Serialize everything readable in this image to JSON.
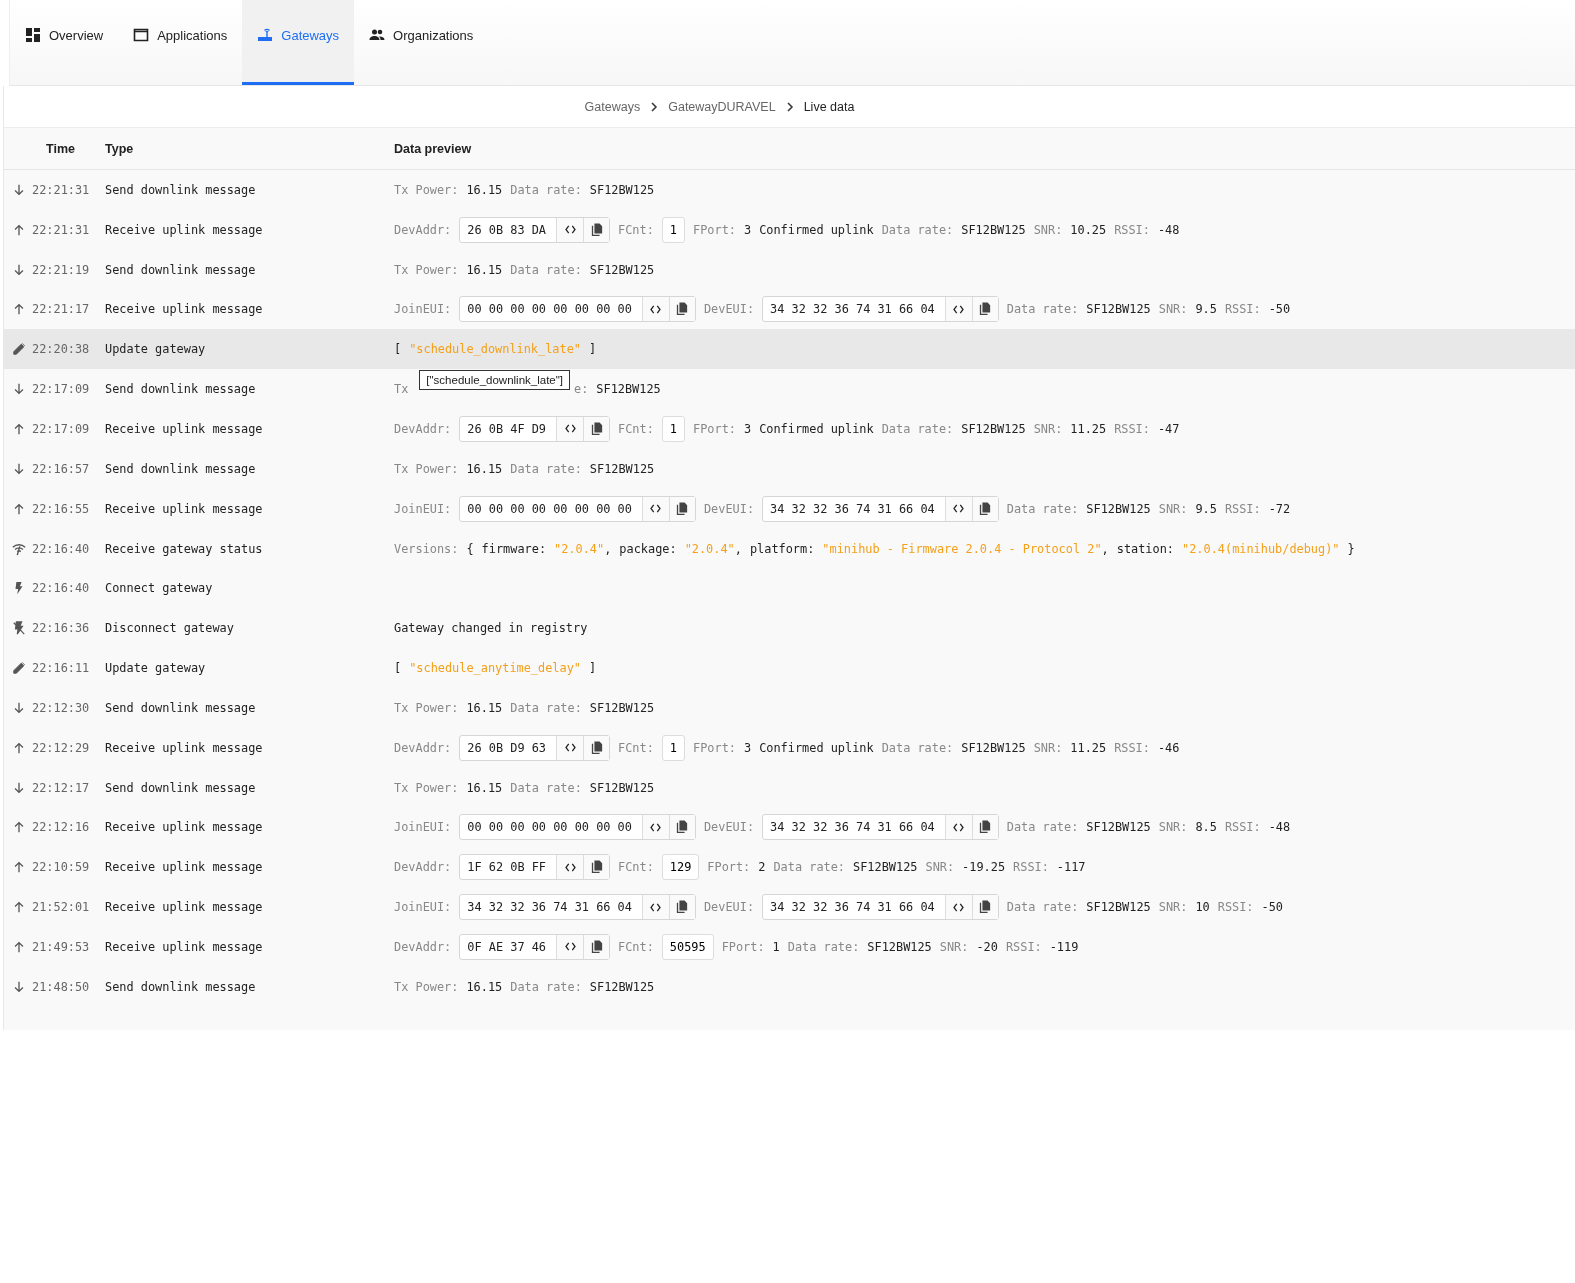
{
  "nav": {
    "tabs": [
      {
        "label": "Overview",
        "kind": "dashboard",
        "selected": false
      },
      {
        "label": "Applications",
        "kind": "window",
        "selected": false
      },
      {
        "label": "Gateways",
        "kind": "router",
        "selected": true
      },
      {
        "label": "Organizations",
        "kind": "people",
        "selected": false
      }
    ]
  },
  "breadcrumb": [
    {
      "label": "Gateways",
      "current": false
    },
    {
      "label": "GatewayDURAVEL",
      "current": false
    },
    {
      "label": "Live data",
      "current": true
    }
  ],
  "table": {
    "columns": [
      "Time",
      "Type",
      "Data preview"
    ],
    "rows": [
      {
        "kind": "down",
        "time": "22:21:31",
        "type": "Send downlink message",
        "highlighted": false,
        "preview": [
          {
            "kind": "label",
            "text": "Tx Power:"
          },
          {
            "kind": "value",
            "text": "16.15"
          },
          {
            "kind": "label",
            "text": "Data rate:"
          },
          {
            "kind": "value",
            "text": "SF12BW125"
          }
        ]
      },
      {
        "kind": "up",
        "time": "22:21:31",
        "type": "Receive uplink message",
        "highlighted": false,
        "preview": [
          {
            "kind": "label",
            "text": "DevAddr:"
          },
          {
            "kind": "field",
            "text": "26 0B 83 DA"
          },
          {
            "kind": "label",
            "text": "FCnt:"
          },
          {
            "kind": "box",
            "text": "1"
          },
          {
            "kind": "label",
            "text": "FPort:"
          },
          {
            "kind": "value",
            "text": "3"
          },
          {
            "kind": "value",
            "text": "Confirmed uplink"
          },
          {
            "kind": "label",
            "text": "Data rate:"
          },
          {
            "kind": "value",
            "text": "SF12BW125"
          },
          {
            "kind": "label",
            "text": "SNR:"
          },
          {
            "kind": "value",
            "text": "10.25"
          },
          {
            "kind": "label",
            "text": "RSSI:"
          },
          {
            "kind": "value",
            "text": "-48"
          }
        ]
      },
      {
        "kind": "down",
        "time": "22:21:19",
        "type": "Send downlink message",
        "highlighted": false,
        "preview": [
          {
            "kind": "label",
            "text": "Tx Power:"
          },
          {
            "kind": "value",
            "text": "16.15"
          },
          {
            "kind": "label",
            "text": "Data rate:"
          },
          {
            "kind": "value",
            "text": "SF12BW125"
          }
        ]
      },
      {
        "kind": "up",
        "time": "22:21:17",
        "type": "Receive uplink message",
        "highlighted": false,
        "preview": [
          {
            "kind": "label",
            "text": "JoinEUI:"
          },
          {
            "kind": "field",
            "text": "00 00 00 00 00 00 00 00"
          },
          {
            "kind": "label",
            "text": "DevEUI:"
          },
          {
            "kind": "field",
            "text": "34 32 32 36 74 31 66 04"
          },
          {
            "kind": "label",
            "text": "Data rate:"
          },
          {
            "kind": "value",
            "text": "SF12BW125"
          },
          {
            "kind": "label",
            "text": "SNR:"
          },
          {
            "kind": "value",
            "text": "9.5"
          },
          {
            "kind": "label",
            "text": "RSSI:"
          },
          {
            "kind": "value",
            "text": "-50"
          }
        ]
      },
      {
        "kind": "edit",
        "time": "22:20:38",
        "type": "Update gateway",
        "highlighted": true,
        "preview": [
          {
            "kind": "value",
            "text": "["
          },
          {
            "kind": "string",
            "text": "\"schedule_downlink_late\""
          },
          {
            "kind": "value",
            "text": "]"
          }
        ]
      },
      {
        "kind": "down",
        "time": "22:17:09",
        "type": "Send downlink message",
        "highlighted": false,
        "preview": [
          {
            "kind": "label",
            "text": "Tx"
          },
          {
            "kind": "tooltip",
            "text": "[\"schedule_downlink_late\"]"
          },
          {
            "kind": "label",
            "text": "e:"
          },
          {
            "kind": "value",
            "text": "SF12BW125"
          }
        ]
      },
      {
        "kind": "up",
        "time": "22:17:09",
        "type": "Receive uplink message",
        "highlighted": false,
        "preview": [
          {
            "kind": "label",
            "text": "DevAddr:"
          },
          {
            "kind": "field",
            "text": "26 0B 4F D9"
          },
          {
            "kind": "label",
            "text": "FCnt:"
          },
          {
            "kind": "box",
            "text": "1"
          },
          {
            "kind": "label",
            "text": "FPort:"
          },
          {
            "kind": "value",
            "text": "3"
          },
          {
            "kind": "value",
            "text": "Confirmed uplink"
          },
          {
            "kind": "label",
            "text": "Data rate:"
          },
          {
            "kind": "value",
            "text": "SF12BW125"
          },
          {
            "kind": "label",
            "text": "SNR:"
          },
          {
            "kind": "value",
            "text": "11.25"
          },
          {
            "kind": "label",
            "text": "RSSI:"
          },
          {
            "kind": "value",
            "text": "-47"
          }
        ]
      },
      {
        "kind": "down",
        "time": "22:16:57",
        "type": "Send downlink message",
        "highlighted": false,
        "preview": [
          {
            "kind": "label",
            "text": "Tx Power:"
          },
          {
            "kind": "value",
            "text": "16.15"
          },
          {
            "kind": "label",
            "text": "Data rate:"
          },
          {
            "kind": "value",
            "text": "SF12BW125"
          }
        ]
      },
      {
        "kind": "up",
        "time": "22:16:55",
        "type": "Receive uplink message",
        "highlighted": false,
        "preview": [
          {
            "kind": "label",
            "text": "JoinEUI:"
          },
          {
            "kind": "field",
            "text": "00 00 00 00 00 00 00 00"
          },
          {
            "kind": "label",
            "text": "DevEUI:"
          },
          {
            "kind": "field",
            "text": "34 32 32 36 74 31 66 04"
          },
          {
            "kind": "label",
            "text": "Data rate:"
          },
          {
            "kind": "value",
            "text": "SF12BW125"
          },
          {
            "kind": "label",
            "text": "SNR:"
          },
          {
            "kind": "value",
            "text": "9.5"
          },
          {
            "kind": "label",
            "text": "RSSI:"
          },
          {
            "kind": "value",
            "text": "-72"
          }
        ]
      },
      {
        "kind": "status",
        "time": "22:16:40",
        "type": "Receive gateway status",
        "highlighted": false,
        "preview": [
          {
            "kind": "label",
            "text": "Versions:"
          },
          {
            "kind": "value",
            "text": "{"
          },
          {
            "kind": "value",
            "text": "firmware:"
          },
          {
            "kind": "string",
            "text": "\"2.0.4\""
          },
          {
            "kind": "punct",
            "text": ","
          },
          {
            "kind": "value",
            "text": "package:"
          },
          {
            "kind": "string",
            "text": "\"2.0.4\""
          },
          {
            "kind": "punct",
            "text": ","
          },
          {
            "kind": "value",
            "text": "platform:"
          },
          {
            "kind": "string",
            "text": "\"minihub - Firmware 2.0.4 - Protocol 2\""
          },
          {
            "kind": "punct",
            "text": ","
          },
          {
            "kind": "value",
            "text": "station:"
          },
          {
            "kind": "string",
            "text": "\"2.0.4(minihub/debug)\""
          },
          {
            "kind": "value",
            "text": "}"
          }
        ]
      },
      {
        "kind": "connect",
        "time": "22:16:40",
        "type": "Connect gateway",
        "highlighted": false,
        "preview": []
      },
      {
        "kind": "disconnect",
        "time": "22:16:36",
        "type": "Disconnect gateway",
        "highlighted": false,
        "preview": [
          {
            "kind": "value",
            "text": "Gateway changed in registry"
          }
        ]
      },
      {
        "kind": "edit",
        "time": "22:16:11",
        "type": "Update gateway",
        "highlighted": false,
        "preview": [
          {
            "kind": "value",
            "text": "["
          },
          {
            "kind": "string",
            "text": "\"schedule_anytime_delay\""
          },
          {
            "kind": "value",
            "text": "]"
          }
        ]
      },
      {
        "kind": "down",
        "time": "22:12:30",
        "type": "Send downlink message",
        "highlighted": false,
        "preview": [
          {
            "kind": "label",
            "text": "Tx Power:"
          },
          {
            "kind": "value",
            "text": "16.15"
          },
          {
            "kind": "label",
            "text": "Data rate:"
          },
          {
            "kind": "value",
            "text": "SF12BW125"
          }
        ]
      },
      {
        "kind": "up",
        "time": "22:12:29",
        "type": "Receive uplink message",
        "highlighted": false,
        "preview": [
          {
            "kind": "label",
            "text": "DevAddr:"
          },
          {
            "kind": "field",
            "text": "26 0B D9 63"
          },
          {
            "kind": "label",
            "text": "FCnt:"
          },
          {
            "kind": "box",
            "text": "1"
          },
          {
            "kind": "label",
            "text": "FPort:"
          },
          {
            "kind": "value",
            "text": "3"
          },
          {
            "kind": "value",
            "text": "Confirmed uplink"
          },
          {
            "kind": "label",
            "text": "Data rate:"
          },
          {
            "kind": "value",
            "text": "SF12BW125"
          },
          {
            "kind": "label",
            "text": "SNR:"
          },
          {
            "kind": "value",
            "text": "11.25"
          },
          {
            "kind": "label",
            "text": "RSSI:"
          },
          {
            "kind": "value",
            "text": "-46"
          }
        ]
      },
      {
        "kind": "down",
        "time": "22:12:17",
        "type": "Send downlink message",
        "highlighted": false,
        "preview": [
          {
            "kind": "label",
            "text": "Tx Power:"
          },
          {
            "kind": "value",
            "text": "16.15"
          },
          {
            "kind": "label",
            "text": "Data rate:"
          },
          {
            "kind": "value",
            "text": "SF12BW125"
          }
        ]
      },
      {
        "kind": "up",
        "time": "22:12:16",
        "type": "Receive uplink message",
        "highlighted": false,
        "preview": [
          {
            "kind": "label",
            "text": "JoinEUI:"
          },
          {
            "kind": "field",
            "text": "00 00 00 00 00 00 00 00"
          },
          {
            "kind": "label",
            "text": "DevEUI:"
          },
          {
            "kind": "field",
            "text": "34 32 32 36 74 31 66 04"
          },
          {
            "kind": "label",
            "text": "Data rate:"
          },
          {
            "kind": "value",
            "text": "SF12BW125"
          },
          {
            "kind": "label",
            "text": "SNR:"
          },
          {
            "kind": "value",
            "text": "8.5"
          },
          {
            "kind": "label",
            "text": "RSSI:"
          },
          {
            "kind": "value",
            "text": "-48"
          }
        ]
      },
      {
        "kind": "up",
        "time": "22:10:59",
        "type": "Receive uplink message",
        "highlighted": false,
        "preview": [
          {
            "kind": "label",
            "text": "DevAddr:"
          },
          {
            "kind": "field",
            "text": "1F 62 0B FF"
          },
          {
            "kind": "label",
            "text": "FCnt:"
          },
          {
            "kind": "box",
            "text": "129"
          },
          {
            "kind": "label",
            "text": "FPort:"
          },
          {
            "kind": "value",
            "text": "2"
          },
          {
            "kind": "label",
            "text": "Data rate:"
          },
          {
            "kind": "value",
            "text": "SF12BW125"
          },
          {
            "kind": "label",
            "text": "SNR:"
          },
          {
            "kind": "value",
            "text": "-19.25"
          },
          {
            "kind": "label",
            "text": "RSSI:"
          },
          {
            "kind": "value",
            "text": "-117"
          }
        ]
      },
      {
        "kind": "up",
        "time": "21:52:01",
        "type": "Receive uplink message",
        "highlighted": false,
        "preview": [
          {
            "kind": "label",
            "text": "JoinEUI:"
          },
          {
            "kind": "field",
            "text": "34 32 32 36 74 31 66 04"
          },
          {
            "kind": "label",
            "text": "DevEUI:"
          },
          {
            "kind": "field",
            "text": "34 32 32 36 74 31 66 04"
          },
          {
            "kind": "label",
            "text": "Data rate:"
          },
          {
            "kind": "value",
            "text": "SF12BW125"
          },
          {
            "kind": "label",
            "text": "SNR:"
          },
          {
            "kind": "value",
            "text": "10"
          },
          {
            "kind": "label",
            "text": "RSSI:"
          },
          {
            "kind": "value",
            "text": "-50"
          }
        ]
      },
      {
        "kind": "up",
        "time": "21:49:53",
        "type": "Receive uplink message",
        "highlighted": false,
        "preview": [
          {
            "kind": "label",
            "text": "DevAddr:"
          },
          {
            "kind": "field",
            "text": "0F AE 37 46"
          },
          {
            "kind": "label",
            "text": "FCnt:"
          },
          {
            "kind": "box",
            "text": "50595"
          },
          {
            "kind": "label",
            "text": "FPort:"
          },
          {
            "kind": "value",
            "text": "1"
          },
          {
            "kind": "label",
            "text": "Data rate:"
          },
          {
            "kind": "value",
            "text": "SF12BW125"
          },
          {
            "kind": "label",
            "text": "SNR:"
          },
          {
            "kind": "value",
            "text": "-20"
          },
          {
            "kind": "label",
            "text": "RSSI:"
          },
          {
            "kind": "value",
            "text": "-119"
          }
        ]
      },
      {
        "kind": "down",
        "time": "21:48:50",
        "type": "Send downlink message",
        "highlighted": false,
        "preview": [
          {
            "kind": "label",
            "text": "Tx Power:"
          },
          {
            "kind": "value",
            "text": "16.15"
          },
          {
            "kind": "label",
            "text": "Data rate:"
          },
          {
            "kind": "value",
            "text": "SF12BW125"
          }
        ]
      }
    ]
  }
}
